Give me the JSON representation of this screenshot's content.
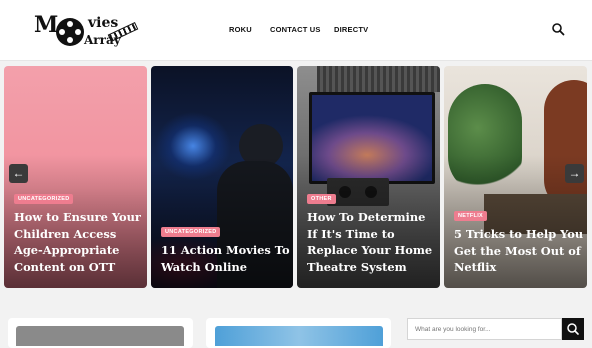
{
  "header": {
    "logo": {
      "part1": "M",
      "part2": "vies",
      "part3": "Array"
    },
    "nav": [
      {
        "label": "ROKU"
      },
      {
        "label": "CONTACT US"
      },
      {
        "label": "DIRECTV"
      }
    ]
  },
  "slides": [
    {
      "badge": "UNCATEGORIZED",
      "title": "How to Ensure Your Children Access Age-Appropriate Content on OTT"
    },
    {
      "badge": "UNCATEGORIZED",
      "title": "11 Action Movies To Watch Online"
    },
    {
      "badge": "OTHER",
      "title": "How To Determine If It's Time to Replace Your Home Theatre System"
    },
    {
      "badge": "NETFLIX",
      "title": "5 Tricks to Help You Get the Most Out of Netflix"
    }
  ],
  "search": {
    "placeholder": "What are you looking for..."
  },
  "colors": {
    "accent": "#ee7d8f",
    "pink_card": "#f1919d",
    "dark": "#111111"
  }
}
